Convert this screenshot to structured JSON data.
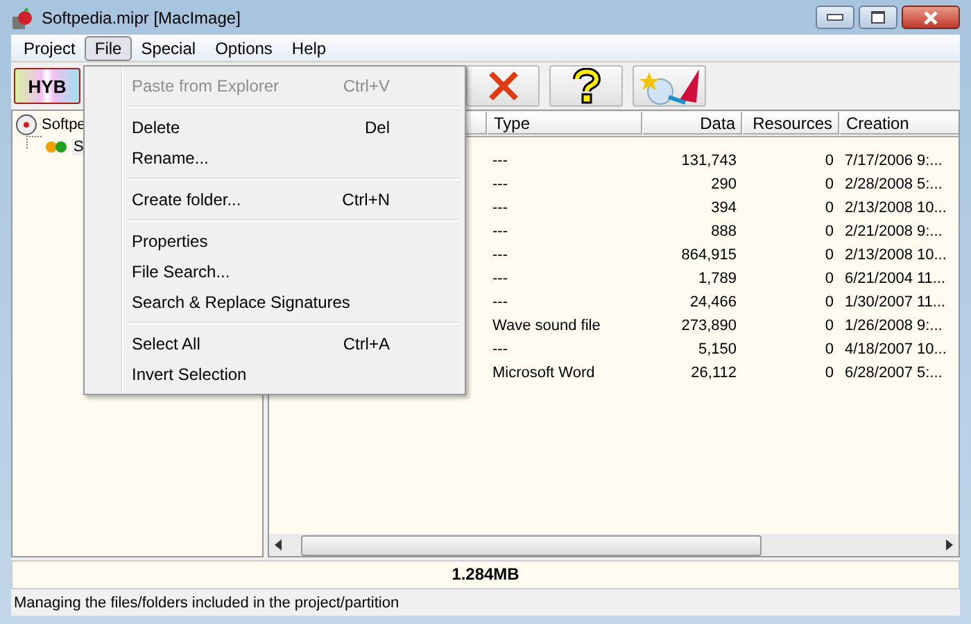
{
  "window": {
    "title": "Softpedia.mipr [MacImage]"
  },
  "menu_bar": [
    {
      "label": "Project",
      "selected": false
    },
    {
      "label": "File",
      "selected": true
    },
    {
      "label": "Special",
      "selected": false
    },
    {
      "label": "Options",
      "selected": false
    },
    {
      "label": "Help",
      "selected": false
    }
  ],
  "file_menu": [
    {
      "kind": "item",
      "label": "Paste from Explorer",
      "shortcut": "Ctrl+V",
      "disabled": true
    },
    {
      "kind": "separator"
    },
    {
      "kind": "item",
      "label": "Delete",
      "shortcut": "Del",
      "disabled": false
    },
    {
      "kind": "item",
      "label": "Rename...",
      "disabled": false
    },
    {
      "kind": "separator"
    },
    {
      "kind": "item",
      "label": "Create folder...",
      "shortcut": "Ctrl+N",
      "disabled": false
    },
    {
      "kind": "separator"
    },
    {
      "kind": "item",
      "label": "Properties",
      "disabled": false
    },
    {
      "kind": "item",
      "label": "File Search...",
      "disabled": false
    },
    {
      "kind": "item",
      "label": "Search & Replace Signatures",
      "disabled": false
    },
    {
      "kind": "separator"
    },
    {
      "kind": "item",
      "label": "Select All",
      "shortcut": "Ctrl+A",
      "disabled": false
    },
    {
      "kind": "item",
      "label": "Invert Selection",
      "disabled": false
    }
  ],
  "toolbar": {
    "format_button": "HYB"
  },
  "tree": [
    {
      "label": "Softpe",
      "children": [
        {
          "label": "S"
        }
      ]
    }
  ],
  "table": {
    "columns": [
      "Type",
      "Data",
      "Resources",
      "Creation"
    ],
    "rows": [
      [
        "---",
        "131,743",
        "0",
        "7/17/2006 9:..."
      ],
      [
        "---",
        "290",
        "0",
        "2/28/2008 5:..."
      ],
      [
        "---",
        "394",
        "0",
        "2/13/2008 10..."
      ],
      [
        "---",
        "888",
        "0",
        "2/21/2008 9:..."
      ],
      [
        "---",
        "864,915",
        "0",
        "2/13/2008 10..."
      ],
      [
        "---",
        "1,789",
        "0",
        "6/21/2004 11..."
      ],
      [
        "---",
        "24,466",
        "0",
        "1/30/2007 11..."
      ],
      [
        "Wave sound file",
        "273,890",
        "0",
        "1/26/2008 9:..."
      ],
      [
        "---",
        "5,150",
        "0",
        "4/18/2007 10..."
      ],
      [
        "Microsoft Word",
        "26,112",
        "0",
        "6/28/2007 5:..."
      ]
    ]
  },
  "size_bar": "1.284MB",
  "status_bar": "Managing the files/folders included in the project/partition"
}
